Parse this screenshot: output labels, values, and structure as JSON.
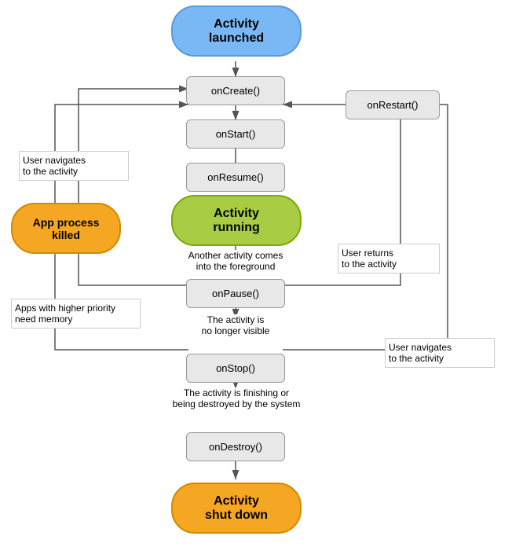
{
  "nodes": {
    "activity_launched": {
      "label": "Activity\nlaunched"
    },
    "on_create": {
      "label": "onCreate()"
    },
    "on_start": {
      "label": "onStart()"
    },
    "on_resume": {
      "label": "onResume()"
    },
    "activity_running": {
      "label": "Activity\nrunning"
    },
    "on_pause": {
      "label": "onPause()"
    },
    "on_stop": {
      "label": "onStop()"
    },
    "on_destroy": {
      "label": "onDestroy()"
    },
    "activity_shutdown": {
      "label": "Activity\nshut down"
    },
    "on_restart": {
      "label": "onRestart()"
    },
    "app_process_killed": {
      "label": "App process\nkilled"
    }
  },
  "labels": {
    "another_activity": {
      "text": "Another activity comes\ninto the foreground"
    },
    "activity_no_longer_visible": {
      "text": "The activity is\nno longer visible"
    },
    "activity_finishing": {
      "text": "The activity is finishing or\nbeing destroyed by the system"
    },
    "user_navigates_to_activity_left": {
      "text": "User navigates\nto the activity"
    },
    "apps_higher_priority": {
      "text": "Apps with higher priority\nneed memory"
    },
    "user_returns": {
      "text": "User returns\nto the activity"
    },
    "user_navigates_right": {
      "text": "User navigates\nto the activity"
    }
  }
}
